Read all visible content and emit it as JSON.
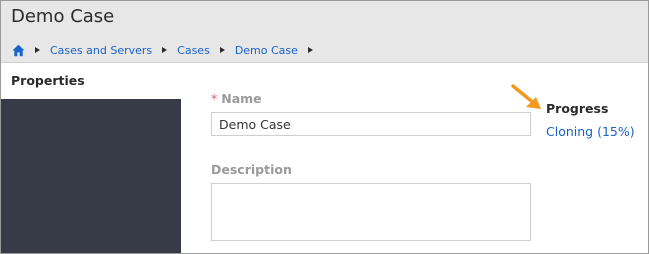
{
  "page": {
    "title": "Demo Case"
  },
  "breadcrumb": {
    "home_icon": "home-icon",
    "items": [
      {
        "label": "Cases and Servers"
      },
      {
        "label": "Cases"
      },
      {
        "label": "Demo Case"
      }
    ]
  },
  "sidebar": {
    "tab_label": "Properties"
  },
  "form": {
    "name_label": "Name",
    "required_marker": "*",
    "name_value": "Demo Case",
    "description_label": "Description",
    "description_value": ""
  },
  "progress": {
    "label": "Progress",
    "value": "Cloning (15%)",
    "percent": 15
  },
  "annotation": {
    "icon": "arrow-icon",
    "color": "#f39a1e"
  },
  "colors": {
    "link": "#1a62c7",
    "sidebar_bg": "#373b47",
    "header_bg": "#e7e7e7"
  }
}
